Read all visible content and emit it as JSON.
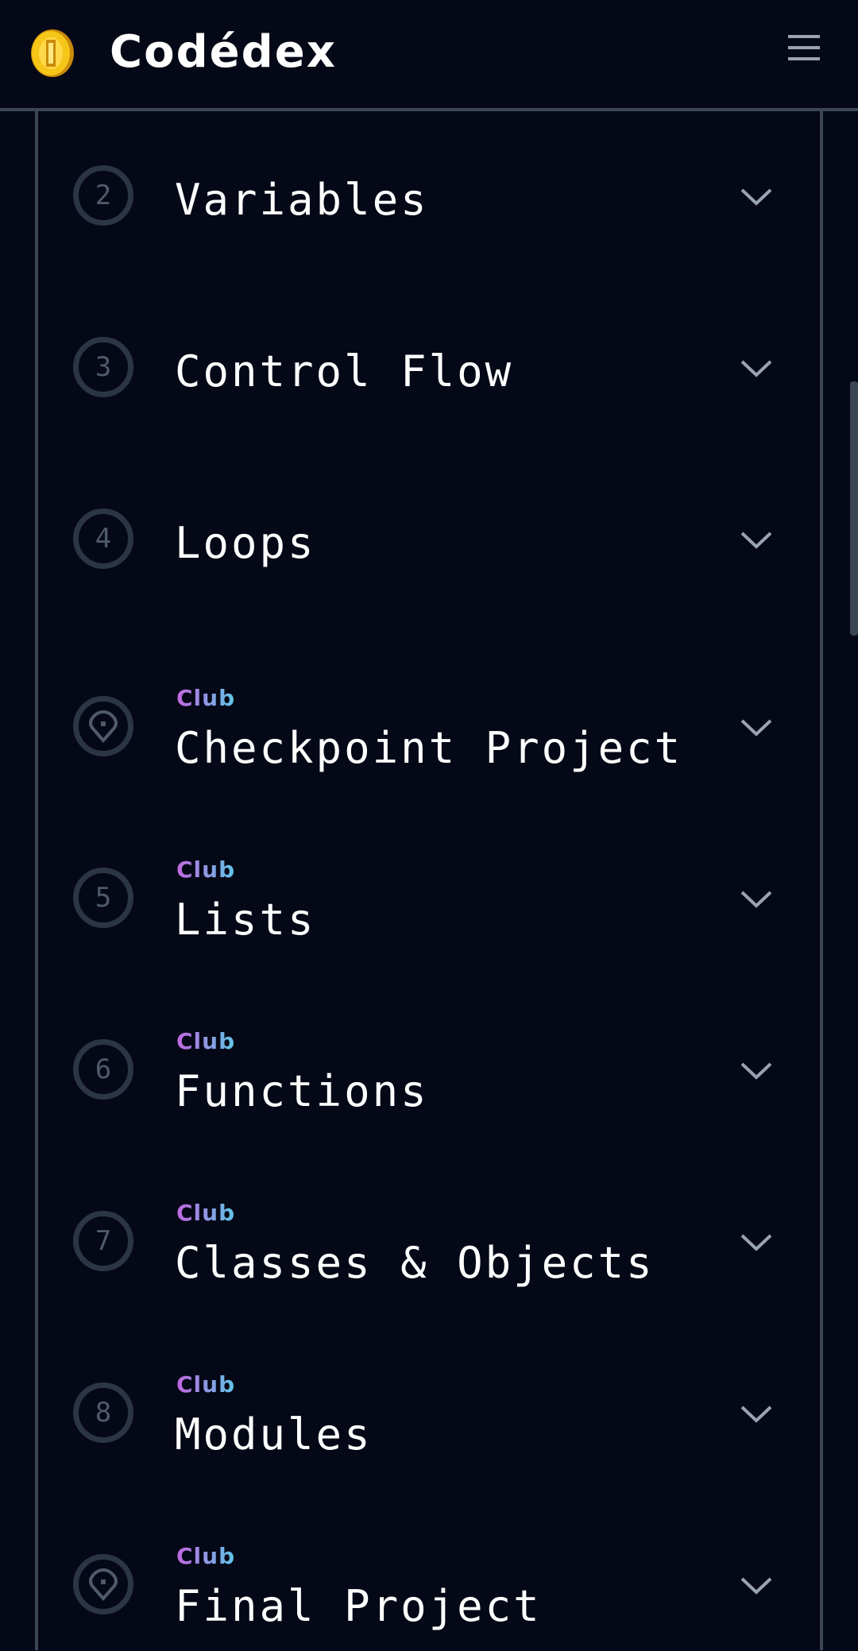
{
  "header": {
    "brand": "Codédex",
    "logo_icon": "gold-coin-icon",
    "menu_icon": "hamburger-menu-icon"
  },
  "colors": {
    "background": "#050816",
    "border": "#3b4655",
    "badge_ring": "#2b3545",
    "club_gradient_start": "#c266e0",
    "club_gradient_end": "#5ec6e8",
    "coin": "#f5c518"
  },
  "chapters": [
    {
      "number": "2",
      "title": "Variables",
      "club": "",
      "icon": "number-badge"
    },
    {
      "number": "3",
      "title": "Control Flow",
      "club": "",
      "icon": "number-badge"
    },
    {
      "number": "4",
      "title": "Loops",
      "club": "",
      "icon": "number-badge"
    },
    {
      "number": "",
      "title": "Checkpoint Project",
      "club": "Club",
      "icon": "map-pin-icon"
    },
    {
      "number": "5",
      "title": "Lists",
      "club": "Club",
      "icon": "number-badge"
    },
    {
      "number": "6",
      "title": "Functions",
      "club": "Club",
      "icon": "number-badge"
    },
    {
      "number": "7",
      "title": "Classes & Objects",
      "club": "Club",
      "icon": "number-badge"
    },
    {
      "number": "8",
      "title": "Modules",
      "club": "Club",
      "icon": "number-badge"
    },
    {
      "number": "",
      "title": "Final Project",
      "club": "Club",
      "icon": "map-pin-icon"
    }
  ]
}
